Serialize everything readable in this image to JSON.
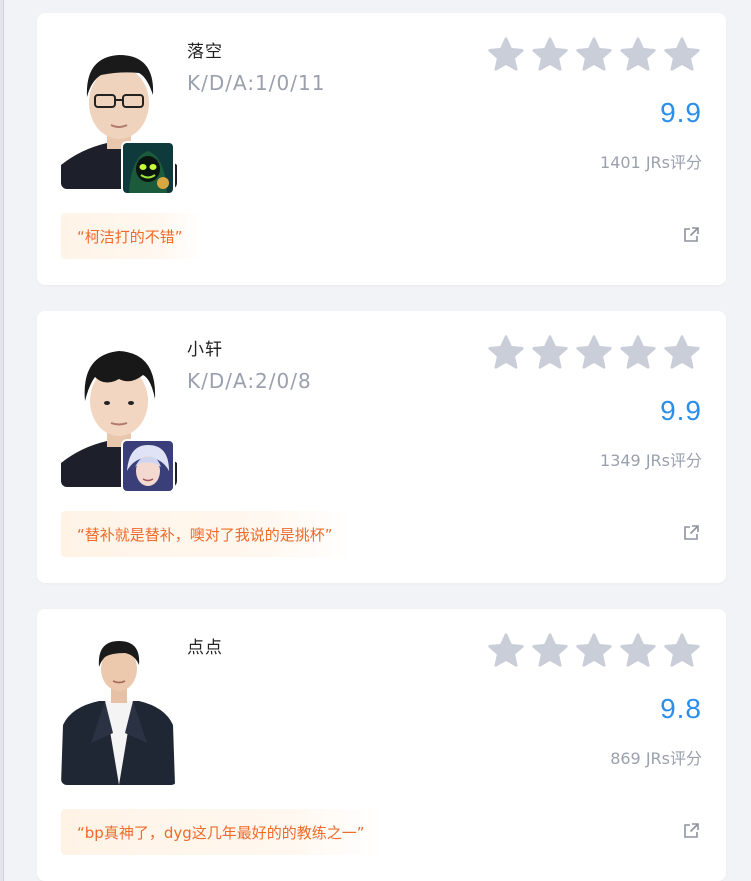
{
  "cards": [
    {
      "name": "落空",
      "kda": "K/D/A:1/0/11",
      "stars_filled": 0,
      "stars_total": 5,
      "score": "9.9",
      "rating_count": "1401 JRs评分",
      "comment": "“柯洁打的不错”",
      "has_hero": true,
      "hero_icon": "green-hooded-hero-icon"
    },
    {
      "name": "小轩",
      "kda": "K/D/A:2/0/8",
      "stars_filled": 0,
      "stars_total": 5,
      "score": "9.9",
      "rating_count": "1349 JRs评分",
      "comment": "“替补就是替补，噢对了我说的是挑杯”",
      "has_hero": true,
      "hero_icon": "silver-haired-hero-icon"
    },
    {
      "name": "点点",
      "kda": "",
      "stars_filled": 0,
      "stars_total": 5,
      "score": "9.8",
      "rating_count": "869 JRs评分",
      "comment": "“bp真神了，dyg这几年最好的的教练之一”",
      "has_hero": false,
      "hero_icon": ""
    }
  ],
  "colors": {
    "score": "#2b8ee8",
    "star": "#c9ced8",
    "comment_text": "#f06a2a",
    "comment_bg": "#fff3e6",
    "page_bg": "#f2f3f6"
  }
}
